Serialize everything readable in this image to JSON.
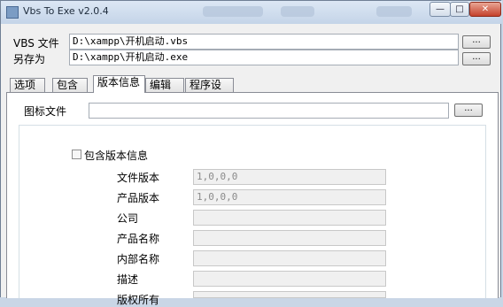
{
  "window": {
    "title": "Vbs To Exe v2.0.4"
  },
  "title_buttons": {
    "minimize": "—",
    "maximize": "□",
    "close": "✕"
  },
  "vbs": {
    "label": "VBS 文件",
    "value": "D:\\xampp\\开机启动.vbs"
  },
  "saveas": {
    "label": "另存为",
    "value": "D:\\xampp\\开机启动.exe"
  },
  "browse_label": "...",
  "tabs": [
    "选项",
    "包含",
    "版本信息",
    "编辑器",
    "程序设置"
  ],
  "icon_file": {
    "label": "图标文件",
    "value": ""
  },
  "include_version": {
    "label": "包含版本信息",
    "checked": false
  },
  "version_fields": [
    {
      "label": "文件版本",
      "value": "1,0,0,0"
    },
    {
      "label": "产品版本",
      "value": "1,0,0,0"
    },
    {
      "label": "公司",
      "value": ""
    },
    {
      "label": "产品名称",
      "value": ""
    },
    {
      "label": "内部名称",
      "value": ""
    },
    {
      "label": "描述",
      "value": ""
    },
    {
      "label": "版权所有",
      "value": ""
    }
  ]
}
